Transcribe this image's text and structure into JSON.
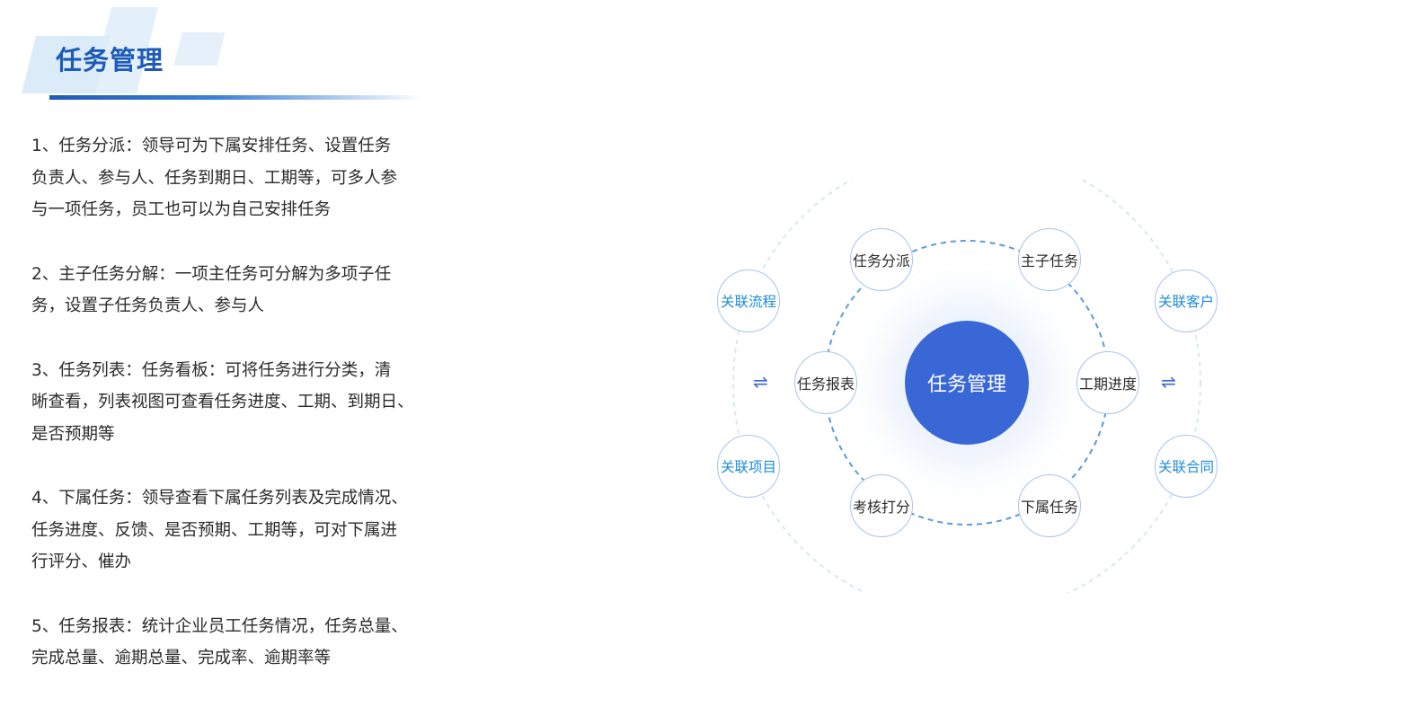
{
  "header": {
    "title": "任务管理"
  },
  "features": [
    {
      "text": "1、任务分派：领导可为下属安排任务、设置任务\n负责人、参与人、任务到期日、工期等，可多人参\n与一项任务，员工也可以为自己安排任务"
    },
    {
      "text": "2、主子任务分解：一项主任务可分解为多项子任\n务，设置子任务负责人、参与人"
    },
    {
      "text": "3、任务列表：任务看板：可将任务进行分类，清\n晰查看，列表视图可查看任务进度、工期、到期日、\n是否预期等"
    },
    {
      "text": "4、下属任务：领导查看下属任务列表及完成情况、\n任务进度、反馈、是否预期、工期等，可对下属进\n行评分、催办"
    },
    {
      "text": "5、任务报表：统计企业员工任务情况，任务总量、\n完成总量、逾期总量、完成率、逾期率等"
    }
  ],
  "diagram": {
    "center": "任务管理",
    "inner_nodes": {
      "assign": "任务分派",
      "subtask": "主子任务",
      "progress": "工期进度",
      "subordinate": "下属任务",
      "scoring": "考核打分",
      "report": "任务报表"
    },
    "outer_nodes": {
      "flow": "关联流程",
      "project": "关联项目",
      "customer": "关联客户",
      "contract": "关联合同"
    },
    "link_symbol": "⇌"
  },
  "colors": {
    "title": "#1e5bb8",
    "center_fill": "#3a67d6",
    "outer_text": "#1a8bd8",
    "node_border": "#a9c4e8",
    "dashed_ring": "#5b9bd6"
  }
}
